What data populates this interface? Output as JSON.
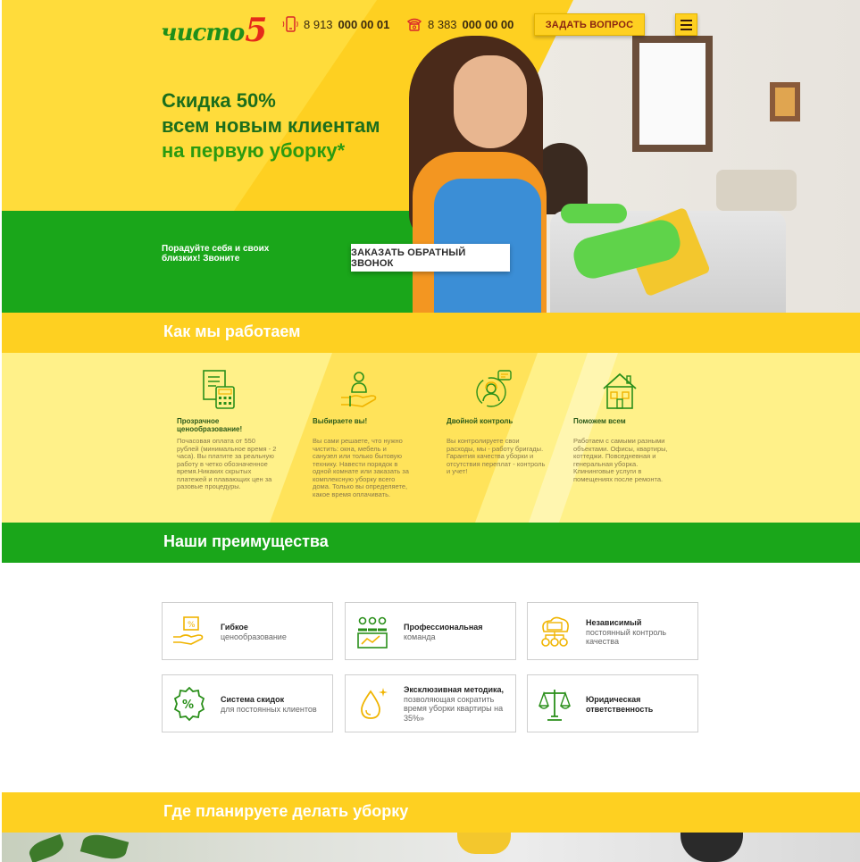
{
  "header": {
    "logo_text": "чисто",
    "logo_number": "5",
    "phone1_prefix": "8 913",
    "phone1_number": "000 00 01",
    "phone2_prefix": "8 383",
    "phone2_number": "000 00 00",
    "ask_button": "ЗАДАТЬ ВОПРОС"
  },
  "hero": {
    "title_line1": "Скидка 50%",
    "title_line2": "всем новым клиентам",
    "title_line3": "на первую уборку*",
    "subtitle": "Порадуйте себя и своих близких! Звоните",
    "callback_button": "ЗАКАЗАТЬ ОБРАТНЫЙ ЗВОНОК"
  },
  "how": {
    "title": "Как мы работаем",
    "steps": [
      {
        "icon": "calculator-document-icon",
        "title": "Прозрачное ценообразование!",
        "text": "Почасовая оплата от 550 рублей (минимальное время - 2 часа). Вы платите за реальную работу в четко обозначенное время.Никаких скрытых платежей и плавающих цен за разовые процедуры."
      },
      {
        "icon": "hand-person-icon",
        "title": "Выбираете вы!",
        "text": "Вы сами решаете, что нужно чистить: окна, мебель и санузел или только бытовую технику. Навести порядок в одной комнате или заказать за комплексную уборку всего дома. Только вы определяете, какое время оплачивать."
      },
      {
        "icon": "operator-headset-icon",
        "title": "Двойной контроль",
        "text": "Вы контролируете свои расходы, мы - работу бригады. Гарантия качества уборки и отсутствия переплат - контроль и учет!"
      },
      {
        "icon": "house-icon",
        "title": "Поможем всем",
        "text": "Работаем с самыми разными объектами. Офисы, квартиры, коттеджи. Повседневная и генеральная уборка. Клининговые услуги в помещениях после ремонта."
      }
    ]
  },
  "advantages": {
    "title": "Наши преимущества",
    "items": [
      {
        "icon": "money-hand-icon",
        "bold": "Гибкое",
        "text": "ценообразование"
      },
      {
        "icon": "professional-team-icon",
        "bold": "Профессиональная",
        "text": "команда"
      },
      {
        "icon": "quality-control-icon",
        "bold": "Независимый",
        "text": "постоянный контроль качества"
      },
      {
        "icon": "discount-badge-icon",
        "bold": "Система скидок",
        "text": "для постоянных клиентов"
      },
      {
        "icon": "drop-sparkle-icon",
        "bold": "Эксклюзивная методика,",
        "text": "позволяющая сократить время уборки квартиры на 35%»"
      },
      {
        "icon": "scales-icon",
        "bold": "Юридическая ответственность",
        "text": ""
      }
    ]
  },
  "where": {
    "title": "Где планируете делать уборку"
  },
  "colors": {
    "yellow": "#fed021",
    "green": "#1aa61a",
    "dark_green": "#1c6e1c",
    "red": "#e52b1a"
  }
}
